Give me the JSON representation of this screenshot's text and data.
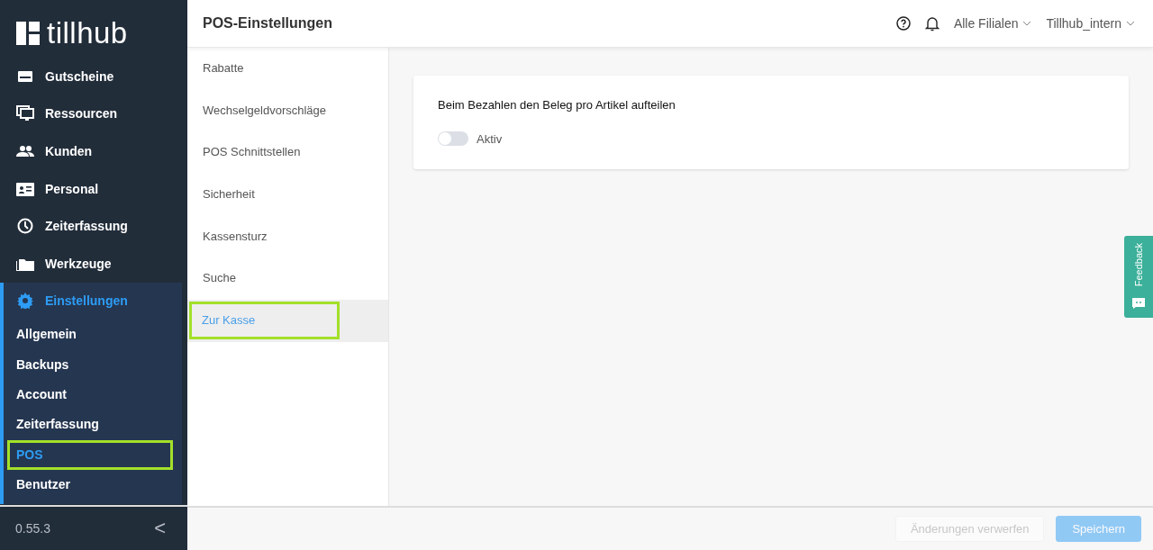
{
  "sidebar": {
    "logo": "tillhub",
    "items": [
      {
        "label": "Gutscheine",
        "selected": false
      },
      {
        "label": "Ressourcen",
        "selected": false
      },
      {
        "label": "Kunden",
        "selected": false
      },
      {
        "label": "Personal",
        "selected": false
      },
      {
        "label": "Zeiterfassung",
        "selected": false
      },
      {
        "label": "Werkzeuge",
        "selected": false
      },
      {
        "label": "Einstellungen",
        "selected": true,
        "expanded": true,
        "children": [
          {
            "label": "Allgemein",
            "selected": false
          },
          {
            "label": "Backups",
            "selected": false
          },
          {
            "label": "Account",
            "selected": false
          },
          {
            "label": "Zeiterfassung",
            "selected": false
          },
          {
            "label": "POS",
            "selected": true
          },
          {
            "label": "Benutzer",
            "selected": false
          }
        ]
      }
    ],
    "version": "0.55.3",
    "collapse": "<"
  },
  "header": {
    "title": "POS-Einstellungen",
    "branch": "Alle Filialen",
    "account": "Tillhub_intern"
  },
  "submenu": [
    {
      "label": "Rabatte",
      "selected": false
    },
    {
      "label": "Wechselgeldvorschläge",
      "selected": false
    },
    {
      "label": "POS Schnittstellen",
      "selected": false
    },
    {
      "label": "Sicherheit",
      "selected": false
    },
    {
      "label": "Kassensturz",
      "selected": false
    },
    {
      "label": "Suche",
      "selected": false
    },
    {
      "label": "Zur Kasse",
      "selected": true
    }
  ],
  "card": {
    "title": "Beim Bezahlen den Beleg pro Artikel aufteilen",
    "toggle": {
      "label": "Aktiv",
      "on": false
    }
  },
  "footer": {
    "buttons": [
      {
        "label": "Änderungen verwerfen",
        "kind": "secondary",
        "disabled": true
      },
      {
        "label": "Speichern",
        "kind": "primary",
        "disabled": true
      }
    ]
  },
  "feedback": "Feedback"
}
